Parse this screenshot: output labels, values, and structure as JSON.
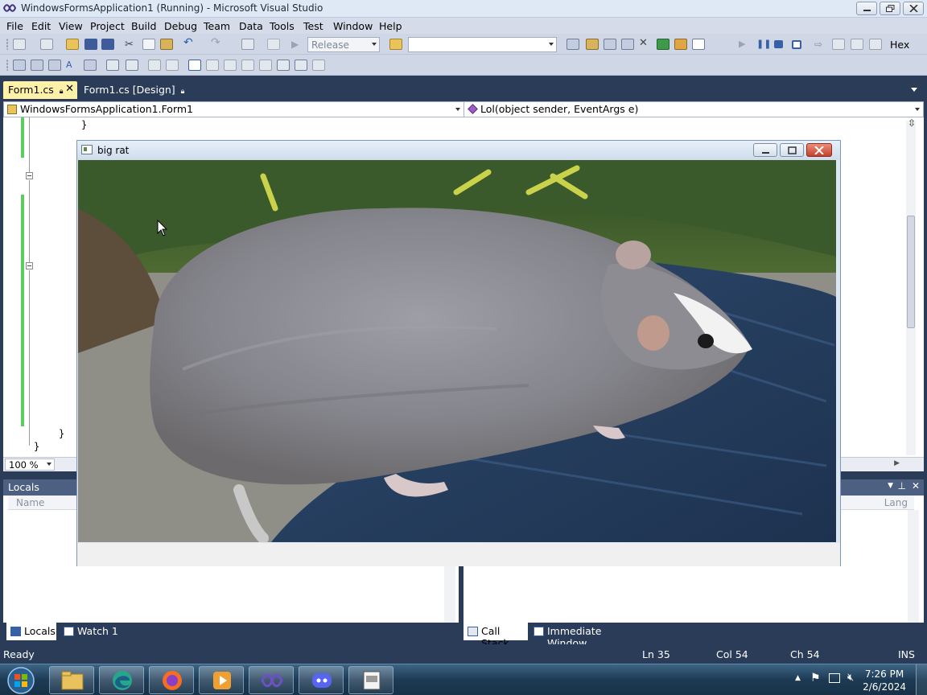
{
  "window": {
    "title": "WindowsFormsApplication1 (Running) - Microsoft Visual Studio"
  },
  "menu": [
    "File",
    "Edit",
    "View",
    "Project",
    "Build",
    "Debug",
    "Team",
    "Data",
    "Tools",
    "Test",
    "Window",
    "Help"
  ],
  "toolbar": {
    "config": "Release",
    "platform": "",
    "hex_label": "Hex"
  },
  "tabs": [
    {
      "label": "Form1.cs",
      "active": true
    },
    {
      "label": "Form1.cs [Design]",
      "active": false
    }
  ],
  "navigation": {
    "type": "WindowsFormsApplication1.Form1",
    "member": "Lol(object sender, EventArgs e)"
  },
  "code_lines": [
    "}",
    "}",
    "}"
  ],
  "zoom": "100 %",
  "locals": {
    "title": "Locals",
    "col_name": "Name",
    "col_lang": "Lang"
  },
  "bottom_tabs": {
    "left": [
      "Locals",
      "Watch 1"
    ],
    "right": [
      "Call Stack",
      "Immediate Window"
    ]
  },
  "status": {
    "ready": "Ready",
    "ln": "Ln 35",
    "col": "Col 54",
    "ch": "Ch 54",
    "mode": "INS"
  },
  "form": {
    "title": "big rat"
  },
  "clock": {
    "time": "7:26 PM",
    "date": "2/6/2024"
  },
  "taskbar_apps": [
    "file-explorer",
    "edge",
    "firefox",
    "media-player",
    "visual-studio",
    "discord",
    "form-app"
  ],
  "colors": {
    "vs_blue": "#2b3c59",
    "active_tab": "#fff1a8",
    "change_bar": "#5ccc5c"
  }
}
